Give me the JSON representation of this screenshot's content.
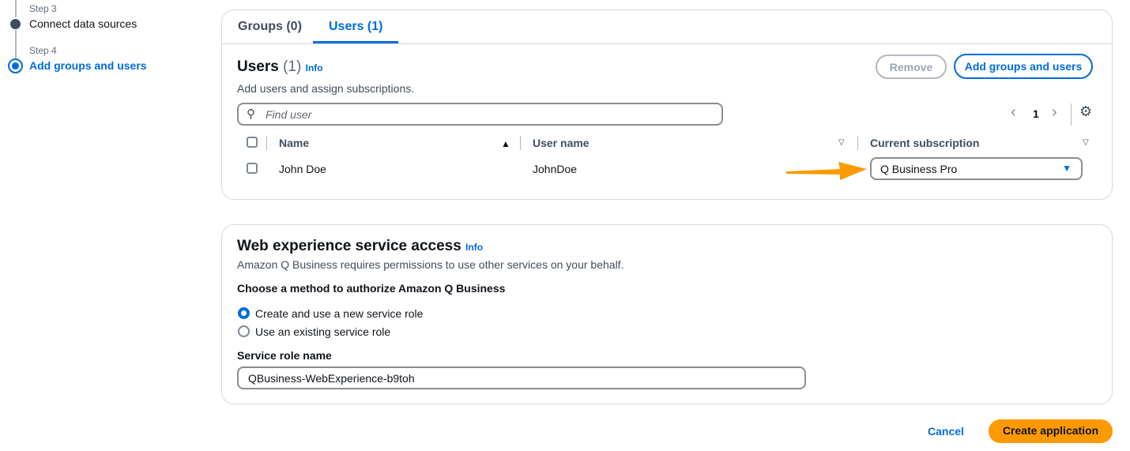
{
  "steps": [
    {
      "label": "Step 3",
      "title": "Connect data sources"
    },
    {
      "label": "Step 4",
      "title": "Add groups and users"
    }
  ],
  "tabs": [
    "Groups (0)",
    "Users (1)"
  ],
  "users": {
    "title": "Users",
    "count": "(1)",
    "info": "Info",
    "description": "Add users and assign subscriptions.",
    "remove": "Remove",
    "add": "Add groups and users",
    "search_placeholder": "Find user",
    "page": "1",
    "columns": [
      "Name",
      "User name",
      "Current subscription"
    ],
    "rows": [
      {
        "name": "John Doe",
        "username": "JohnDoe",
        "subscription": "Q Business Pro"
      }
    ]
  },
  "web": {
    "title": "Web experience service access",
    "info": "Info",
    "description": "Amazon Q Business requires permissions to use other services on your behalf.",
    "method_label": "Choose a method to authorize Amazon Q Business",
    "options": [
      "Create and use a new service role",
      "Use an existing service role"
    ],
    "role_label": "Service role name",
    "role_value": "QBusiness-WebExperience-b9toh"
  },
  "footer": {
    "cancel": "Cancel",
    "create": "Create application"
  },
  "colors": {
    "accent": "#006ce0",
    "primary": "#ff9900"
  }
}
